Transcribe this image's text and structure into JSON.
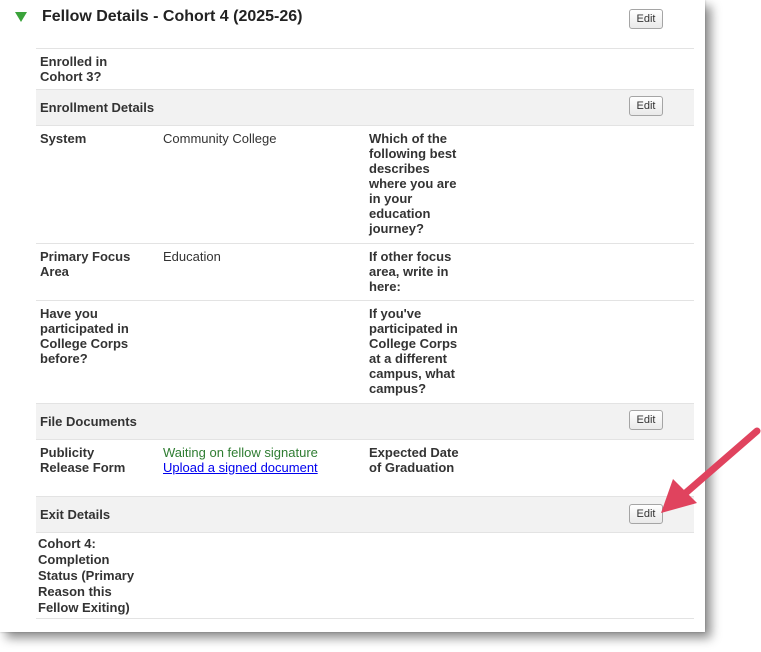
{
  "header": {
    "title": "Fellow Details - Cohort 4 (2025-26)",
    "edit_label": "Edit"
  },
  "top_fields": {
    "enrolled_label": "Enrolled in Cohort 3?"
  },
  "enrollment": {
    "title": "Enrollment Details",
    "edit_label": "Edit",
    "system_label": "System",
    "system_value": "Community College",
    "journey_label": "Which of the following best describes where you are in your education journey?",
    "focus_label": "Primary Focus Area",
    "focus_value": "Education",
    "other_focus_label": "If other focus area, write in here:",
    "participated_label": "Have you participated in College Corps before?",
    "campus_label": "If you've participated in College Corps at a different campus, what campus?"
  },
  "files": {
    "title": "File Documents",
    "edit_label": "Edit",
    "publicity_label": "Publicity Release Form",
    "status_text": "Waiting on fellow signature",
    "upload_link": "Upload a signed document",
    "graduation_label": "Expected Date of Graduation"
  },
  "exit": {
    "title": "Exit Details",
    "edit_label": "Edit",
    "completion_label": "Cohort 4: Completion Status (Primary Reason this Fellow Exiting)"
  },
  "colors": {
    "triangle": "#3aa33a",
    "arrow": "#e0435e",
    "status_green": "#2f7d32",
    "link": "#0000ee"
  }
}
